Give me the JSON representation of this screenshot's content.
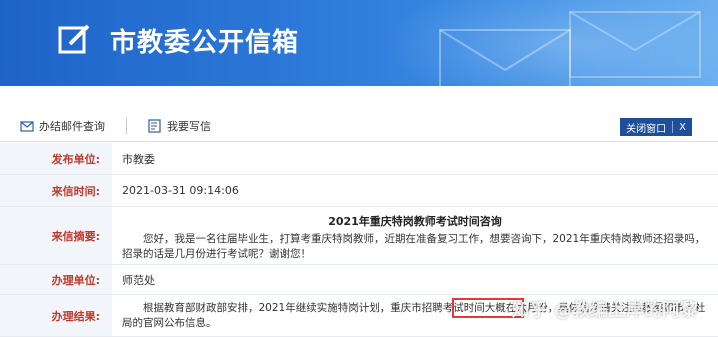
{
  "header": {
    "title": "市教委公开信箱"
  },
  "toolbar": {
    "query_label": "办结邮件查询",
    "write_label": "我要写信",
    "close_label": "关闭窗口",
    "close_symbol": "X"
  },
  "letter": {
    "fields": [
      {
        "label": "发布单位:",
        "value": "市教委"
      },
      {
        "label": "来信时间:",
        "value": "2021-03-31 09:14:06"
      },
      {
        "label": "来信摘要:"
      },
      {
        "label": "办理单位:",
        "value": "师范处"
      },
      {
        "label": "办理结果:"
      }
    ],
    "subject": "2021年重庆特岗教师考试时间咨询",
    "summary": "您好，我是一名往届毕业生，打算考重庆特岗教师，近期在准备复习工作，想要咨询下，2021年重庆特岗教师还招录吗，招录的话是几月份进行考试呢？谢谢您！",
    "result": "根据教育部财政部安排，2021年继续实施特岗计划，重庆市招聘考试时间大概在六月份，具体信息请关注市教委和市人社局的官网公布信息。"
  },
  "watermark": "知乎 @教编上岸的阿黎",
  "colors": {
    "banner": "#2b78d8",
    "label_text": "#c0392b",
    "close_button": "#1d4f9a",
    "highlight": "#e03a3a"
  }
}
